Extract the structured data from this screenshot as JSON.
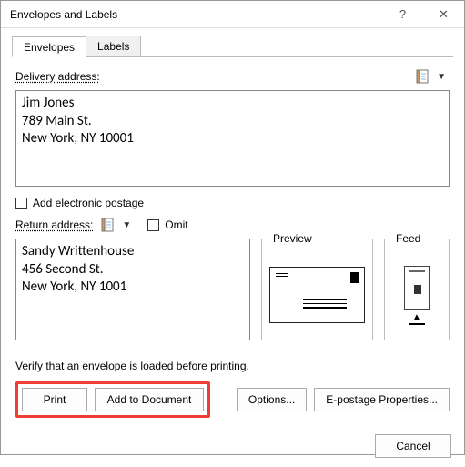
{
  "window": {
    "title": "Envelopes and Labels",
    "help_label": "?",
    "close_label": "✕"
  },
  "tabs": {
    "envelopes": "Envelopes",
    "labels": "Labels"
  },
  "delivery": {
    "label": "Delivery address:",
    "value": "Jim Jones\n789 Main St.\nNew York, NY 10001"
  },
  "electronic_postage": {
    "label": "Add electronic postage"
  },
  "return": {
    "label": "Return address:",
    "omit_label": "Omit",
    "value": "Sandy Writtenhouse\n456 Second St.\nNew York, NY 1001"
  },
  "preview": {
    "label": "Preview"
  },
  "feed": {
    "label": "Feed"
  },
  "verify_text": "Verify that an envelope is loaded before printing.",
  "buttons": {
    "print": "Print",
    "add_to_doc": "Add to Document",
    "options": "Options...",
    "epostage": "E-postage Properties...",
    "cancel": "Cancel"
  }
}
